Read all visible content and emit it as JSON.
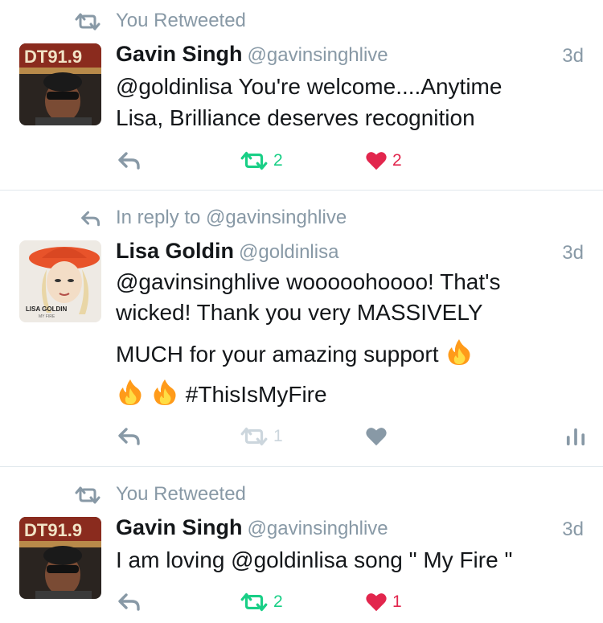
{
  "colors": {
    "retweet_active": "#19cf86",
    "like_active": "#e2264d",
    "secondary_text": "#8899a6",
    "inactive_icon": "#ccd6dd",
    "divider": "#e1e8ed"
  },
  "tweets": [
    {
      "context": {
        "icon": "retweet-icon",
        "text": "You Retweeted"
      },
      "author": {
        "name": "Gavin Singh",
        "handle": "@gavinsinghlive"
      },
      "time": "3d",
      "lines": [
        "@goldinlisa You're welcome....Anytime",
        "Lisa, Brilliance deserves recognition"
      ],
      "actions": {
        "retweets": "2",
        "likes": "2",
        "retweeted": true,
        "liked": true
      }
    },
    {
      "context": {
        "icon": "reply-icon",
        "text": "In reply to @gavinsinghlive"
      },
      "author": {
        "name": "Lisa Goldin",
        "handle": "@goldinlisa"
      },
      "time": "3d",
      "avatar_caption": "LISA GOLDIN",
      "avatar_subcaption": "MY FIRE",
      "lines": [
        "@gavinsinghlive wooooohoooo! That's",
        "wicked! Thank you very MASSIVELY",
        "MUCH for your amazing support",
        "#ThisIsMyFire"
      ],
      "actions": {
        "retweets": "1",
        "likes": "",
        "retweeted": false,
        "liked": false
      }
    },
    {
      "context": {
        "icon": "retweet-icon",
        "text": "You Retweeted"
      },
      "author": {
        "name": "Gavin Singh",
        "handle": "@gavinsinghlive"
      },
      "time": "3d",
      "lines": [
        "I am loving @goldinlisa song \" My Fire \""
      ],
      "actions": {
        "retweets": "2",
        "likes": "1",
        "retweeted": true,
        "liked": true
      }
    }
  ]
}
